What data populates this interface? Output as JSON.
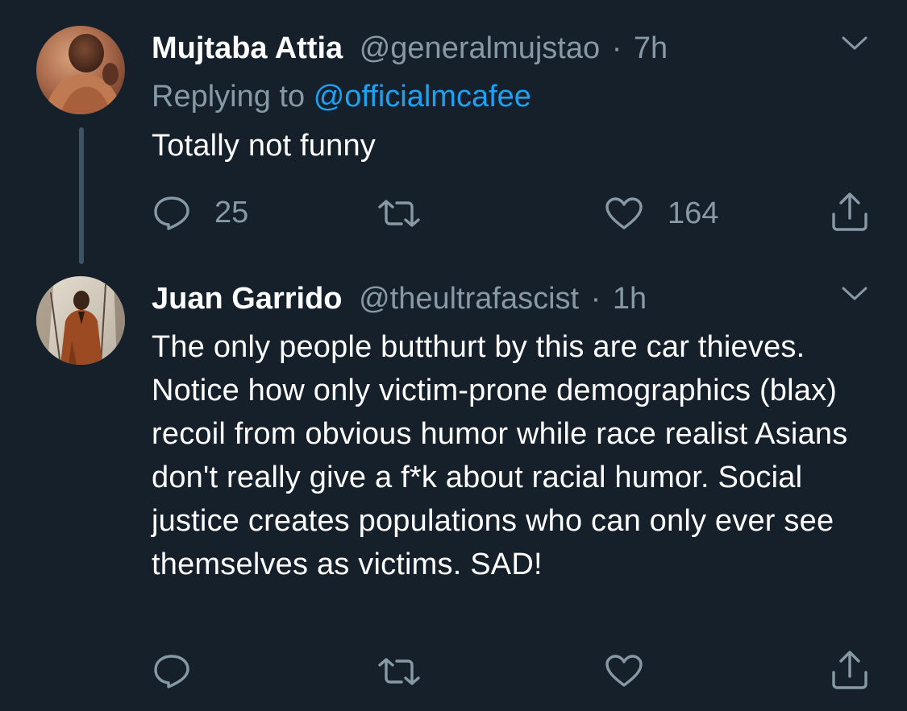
{
  "tweets": [
    {
      "name": "Mujtaba Attia",
      "handle": "@generalmujstao",
      "separator": "·",
      "time": "7h",
      "replying_prefix": "Replying to",
      "replying_to": "@officialmcafee",
      "text": "Totally not funny",
      "actions": {
        "reply_count": "25",
        "retweet_count": "",
        "like_count": "164"
      },
      "icons": {
        "avatar": "profile-photo",
        "menu": "chevron-down-icon",
        "reply": "reply-icon",
        "retweet": "retweet-icon",
        "like": "heart-icon",
        "share": "share-icon"
      }
    },
    {
      "name": "Juan Garrido",
      "handle": "@theultrafascist",
      "separator": "·",
      "time": "1h",
      "text": "The only people butthurt by this are car thieves. Notice how only victim-prone demographics (blax) recoil from obvious humor while race realist Asians don't really give a f*k about racial humor. Social justice creates populations who can only ever see themselves as victims. SAD!",
      "actions": {
        "reply_count": "",
        "retweet_count": "",
        "like_count": ""
      },
      "icons": {
        "avatar": "profile-photo",
        "menu": "chevron-down-icon",
        "reply": "reply-icon",
        "retweet": "retweet-icon",
        "like": "heart-icon",
        "share": "share-icon"
      }
    }
  ],
  "colors": {
    "background": "#15202b",
    "primary_text": "#ffffff",
    "secondary_text": "#8899a6",
    "link": "#1da1f2",
    "thread_line": "#3d5466"
  }
}
